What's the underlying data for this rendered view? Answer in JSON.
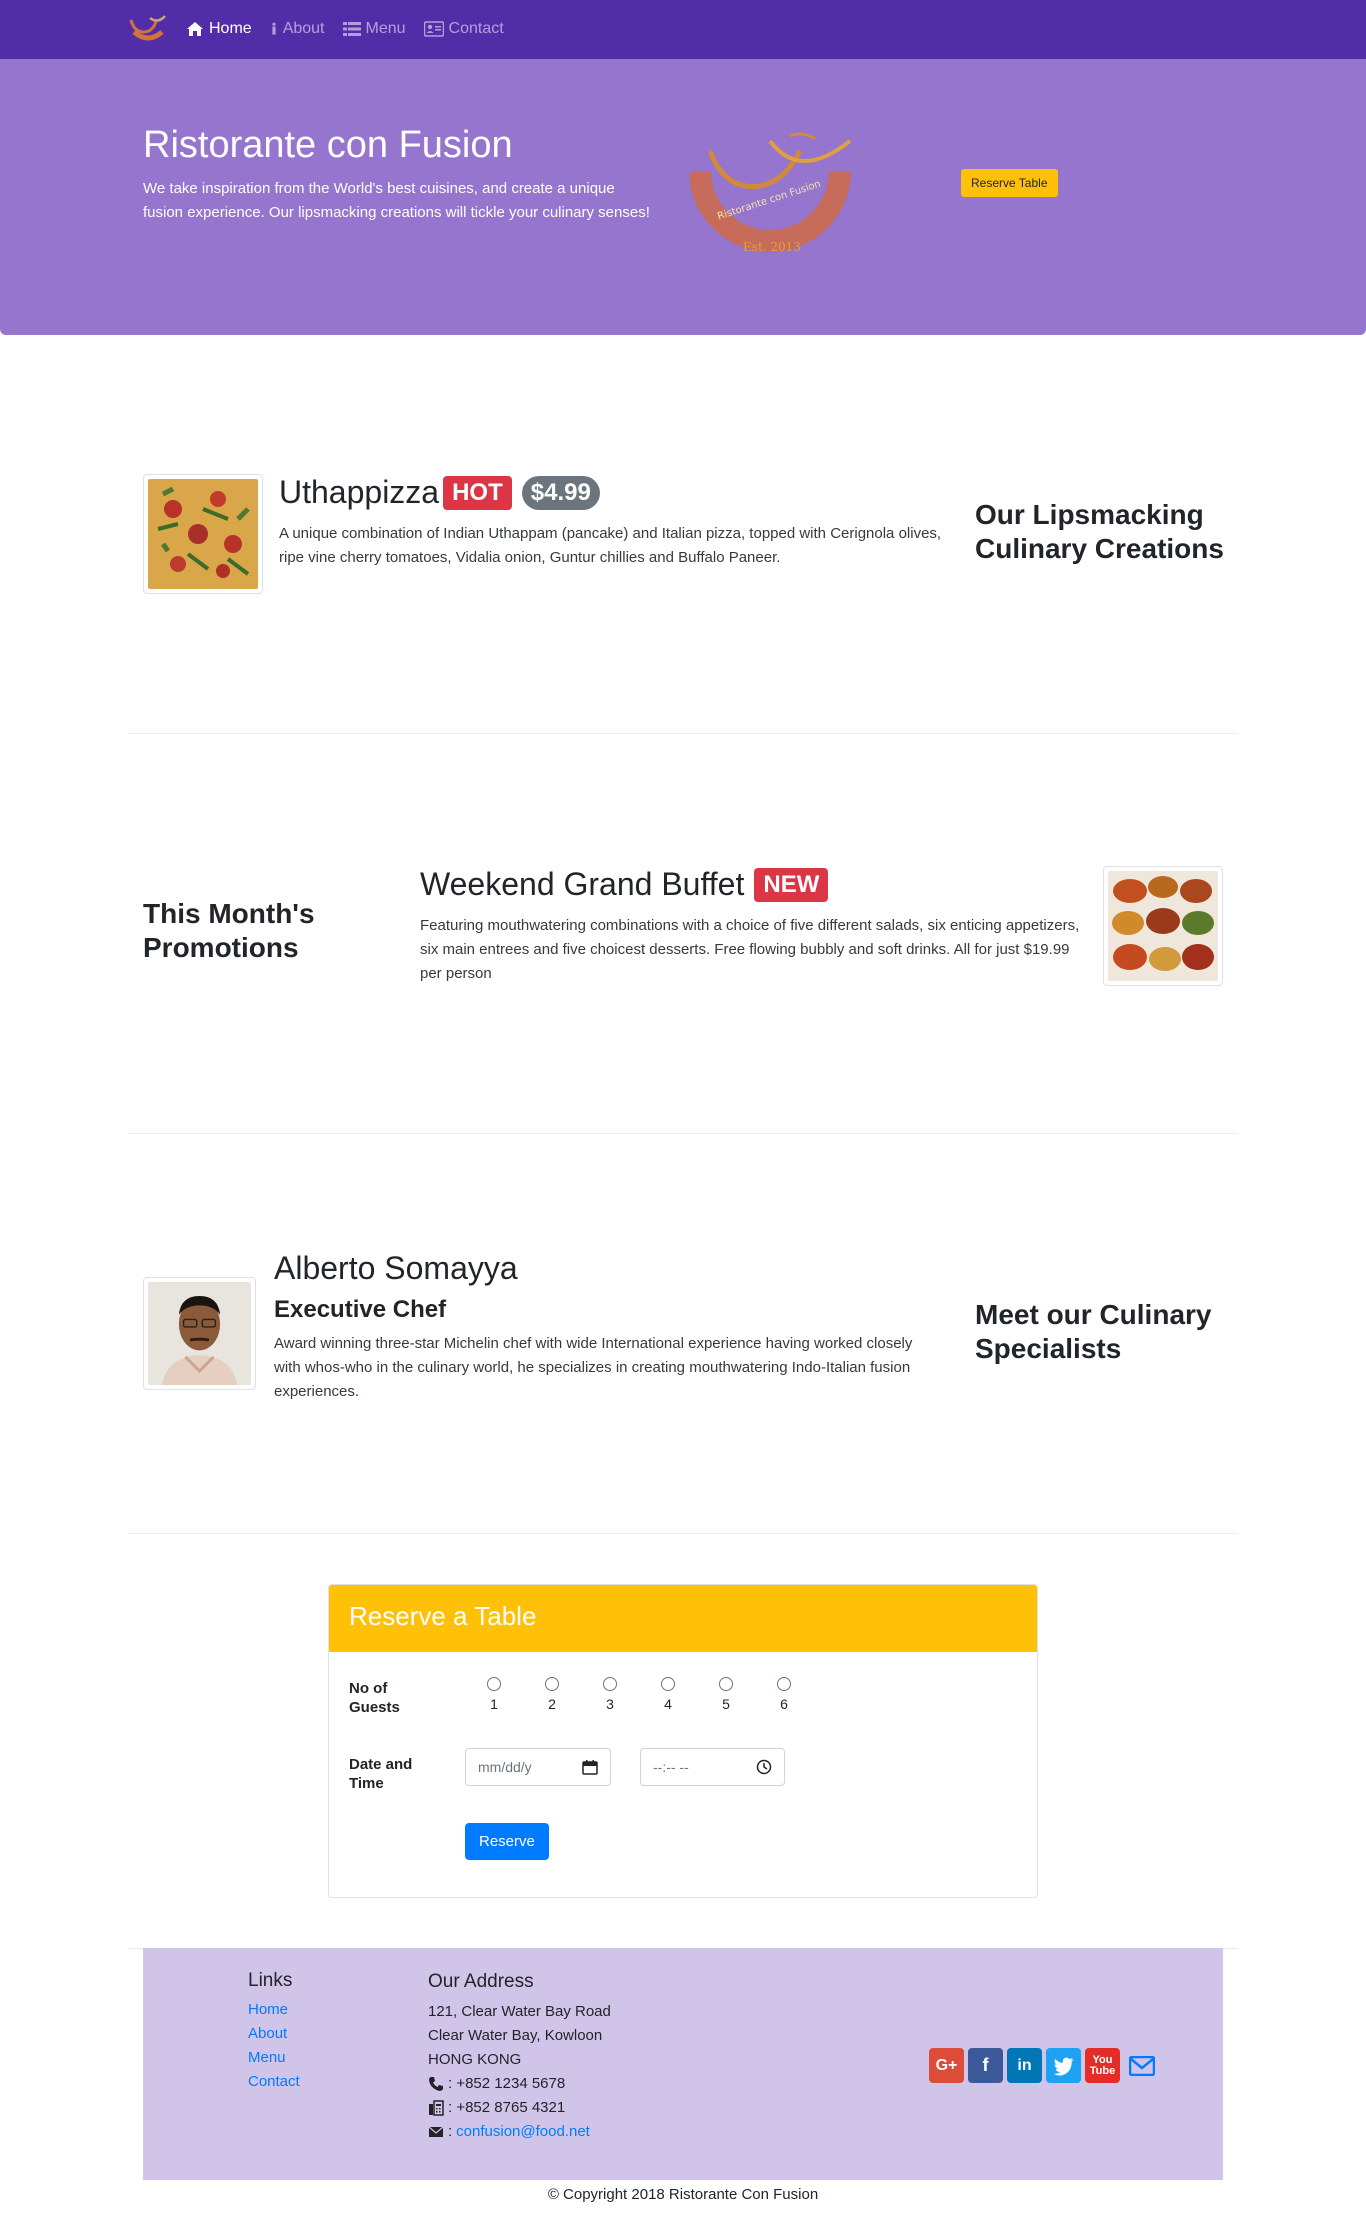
{
  "nav": {
    "items": [
      {
        "label": "Home",
        "icon": "home-icon",
        "active": true
      },
      {
        "label": "About",
        "icon": "info-icon",
        "active": false
      },
      {
        "label": "Menu",
        "icon": "list-icon",
        "active": false
      },
      {
        "label": "Contact",
        "icon": "address-card-icon",
        "active": false
      }
    ]
  },
  "jumbotron": {
    "title": "Ristorante con Fusion",
    "text": "We take inspiration from the World's best cuisines, and create a unique fusion experience. Our lipsmacking creations will tickle your culinary senses!",
    "logo_text": "Ristorante con Fusion",
    "logo_est": "Est. 2013",
    "reserve_label": "Reserve Table"
  },
  "dish": {
    "name": "Uthappizza",
    "badge": "HOT",
    "price": "$4.99",
    "description": "A unique combination of Indian Uthappam (pancake) and Italian pizza, topped with Cerignola olives, ripe vine cherry tomatoes, Vidalia onion, Guntur chillies and Buffalo Paneer.",
    "side_heading": "Our Lipsmacking Culinary Creations"
  },
  "promotion": {
    "side_heading": "This Month's Promotions",
    "name": "Weekend Grand Buffet",
    "badge": "NEW",
    "description": "Featuring mouthwatering combinations with a choice of five different salads, six enticing appetizers, six main entrees and five choicest desserts. Free flowing bubbly and soft drinks. All for just $19.99 per person"
  },
  "leader": {
    "name": "Alberto Somayya",
    "designation": "Executive Chef",
    "description": "Award winning three-star Michelin chef with wide International experience having worked closely with whos-who in the culinary world, he specializes in creating mouthwatering Indo-Italian fusion experiences.",
    "side_heading": "Meet our Culinary Specialists"
  },
  "reserve": {
    "title": "Reserve a Table",
    "guests_label": "No of Guests",
    "guest_options": [
      "1",
      "2",
      "3",
      "4",
      "5",
      "6"
    ],
    "datetime_label": "Date and Time",
    "date_placeholder": "mm/dd/y",
    "time_placeholder": "--:-- --",
    "submit_label": "Reserve"
  },
  "footer": {
    "links_heading": "Links",
    "links": [
      "Home",
      "About",
      "Menu",
      "Contact"
    ],
    "address_heading": "Our Address",
    "address_lines": [
      "121, Clear Water Bay Road",
      "Clear Water Bay, Kowloon",
      "HONG KONG"
    ],
    "phone": ": +852 1234 5678",
    "fax": ": +852 8765 4321",
    "email": "confusion@food.net",
    "social": [
      "google-plus-icon",
      "facebook-icon",
      "linkedin-icon",
      "twitter-icon",
      "youtube-icon",
      "mail-icon"
    ],
    "copyright": "© Copyright 2018 Ristorante Con Fusion"
  },
  "colors": {
    "navbar": "#512da8",
    "jumbotron": "#9575cd",
    "footer": "#d1c4e9",
    "warning": "#ffc107",
    "danger": "#dc3545",
    "primary": "#007bff"
  }
}
